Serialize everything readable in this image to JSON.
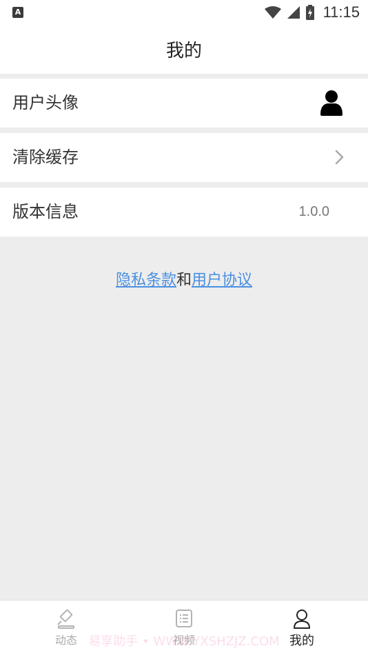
{
  "status_bar": {
    "app_icon_letter": "A",
    "time": "11:15"
  },
  "header": {
    "title": "我的"
  },
  "settings": {
    "avatar_label": "用户头像",
    "cache_label": "清除缓存",
    "version_label": "版本信息",
    "version_value": "1.0.0"
  },
  "links": {
    "privacy": "隐私条款",
    "conjunction": "和",
    "agreement": "用户协议"
  },
  "bottom_nav": {
    "items": [
      {
        "label": "动态",
        "icon": "gavel-icon"
      },
      {
        "label": "视频",
        "icon": "list-icon"
      },
      {
        "label": "我的",
        "icon": "person-icon"
      }
    ],
    "active_index": 2
  },
  "watermark": "易享助手 • WWW.YXSHZJZ.COM"
}
